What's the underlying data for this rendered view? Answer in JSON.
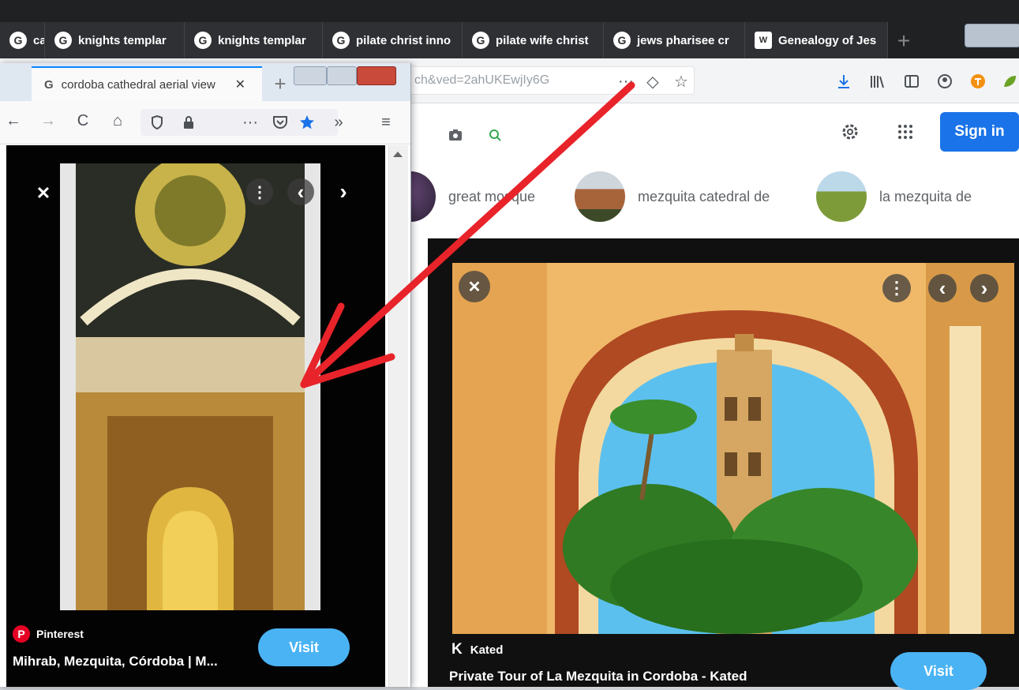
{
  "back_browser": {
    "tabs": [
      {
        "label": "can",
        "icon": "google-icon"
      },
      {
        "label": "knights templar",
        "icon": "google-icon"
      },
      {
        "label": "knights templar",
        "icon": "google-icon"
      },
      {
        "label": "pilate christ inno",
        "icon": "google-icon"
      },
      {
        "label": "pilate wife christ",
        "icon": "google-icon"
      },
      {
        "label": "jews pharisee cr",
        "icon": "google-icon"
      },
      {
        "label": "Genealogy of Jes",
        "icon": "wikipedia-icon"
      }
    ],
    "new_tab_glyph": "+",
    "url_text": "ch&ved=2ahUKEwjIy6G",
    "url_icons": {
      "more": "···",
      "pocket": "◇",
      "star": "☆"
    },
    "toolbar_icons": [
      "download-icon",
      "library-icon",
      "sidebar-icon",
      "account-icon",
      "extension-icon"
    ],
    "sign_in_label": "Sign in",
    "related_chips": [
      {
        "label": "great mosque"
      },
      {
        "label": "mezquita catedral de"
      },
      {
        "label": "la mezquita de"
      }
    ],
    "result": {
      "source": "Kated",
      "source_logo": "K",
      "title": "Private Tour of La Mezquita in Cordoba - Kated",
      "visit_label": "Visit"
    }
  },
  "front_browser": {
    "tab_title": "cordoba cathedral aerial view",
    "tab_close": "✕",
    "new_tab_glyph": "+",
    "nav_glyphs": {
      "back": "←",
      "forward": "→",
      "reload": "C",
      "home": "⌂",
      "more": "···",
      "overflow": "»",
      "menu": "≡"
    },
    "result": {
      "source": "Pinterest",
      "title": "Mihrab, Mezquita, Córdoba | M...",
      "visit_label": "Visit"
    }
  },
  "viewer_controls": {
    "close": "✕",
    "more": "⋮",
    "prev": "‹",
    "next": "›"
  },
  "colors": {
    "arrow": "#e8232a",
    "visit": "#4ab3f4",
    "signin": "#1a73e8",
    "tabstrip_dark": "#1f2123"
  }
}
